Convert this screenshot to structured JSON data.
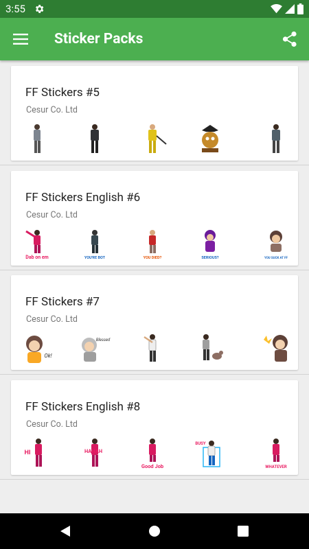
{
  "status_bar": {
    "time": "3:55",
    "icons": [
      "gear-icon",
      "wifi-icon",
      "cell-signal-icon",
      "battery-icon"
    ]
  },
  "app_bar": {
    "title": "Sticker Packs",
    "icons": [
      "hamburger-menu-icon",
      "share-icon"
    ]
  },
  "colors": {
    "status_bar": "#2e7d32",
    "app_bar": "#4caf50",
    "background": "#eeeeee",
    "card": "#ffffff",
    "title_text": "#222222",
    "publisher_text": "#777777",
    "sticker_caption_pink": "#e91e63",
    "sticker_caption_blue": "#1565c0",
    "sticker_caption_orange": "#e65100"
  },
  "packs": [
    {
      "name": "FF Stickers #5",
      "publisher": "Cesur Co. Ltd",
      "stickers": [
        {
          "kind": "character"
        },
        {
          "kind": "character"
        },
        {
          "kind": "character"
        },
        {
          "kind": "pirate-emblem"
        },
        {
          "kind": "character"
        }
      ]
    },
    {
      "name": "FF Stickers English #6",
      "publisher": "Cesur Co. Ltd",
      "stickers": [
        {
          "kind": "character",
          "caption": "Dab on em"
        },
        {
          "kind": "character",
          "caption": "YOU'RE BOT"
        },
        {
          "kind": "character",
          "caption": "YOU DIED?"
        },
        {
          "kind": "character",
          "caption": "SERIOUS?"
        },
        {
          "kind": "character",
          "caption": "YOU SUCK AT FF"
        }
      ]
    },
    {
      "name": "FF Stickers #7",
      "publisher": "Cesur Co. Ltd",
      "stickers": [
        {
          "kind": "character",
          "caption": "Ok!"
        },
        {
          "kind": "character",
          "caption": "Blessed"
        },
        {
          "kind": "character"
        },
        {
          "kind": "character"
        },
        {
          "kind": "character"
        }
      ]
    },
    {
      "name": "FF Stickers English #8",
      "publisher": "Cesur Co. Ltd",
      "stickers": [
        {
          "kind": "character",
          "caption": "HI"
        },
        {
          "kind": "character",
          "caption": "HAHAH"
        },
        {
          "kind": "character",
          "caption": "Good Job"
        },
        {
          "kind": "character",
          "caption": "BUSY"
        },
        {
          "kind": "character",
          "caption": "WHATEVER"
        }
      ]
    }
  ],
  "nav_bar": {
    "icons": [
      "back-icon",
      "home-icon",
      "recents-icon"
    ]
  }
}
